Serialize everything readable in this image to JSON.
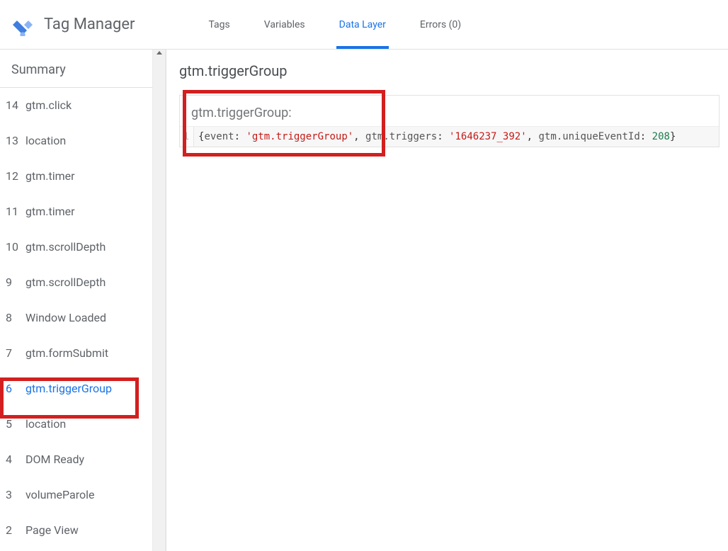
{
  "app_title": "Tag Manager",
  "tabs": [
    {
      "label": "Tags",
      "active": false
    },
    {
      "label": "Variables",
      "active": false
    },
    {
      "label": "Data Layer",
      "active": true
    },
    {
      "label": "Errors (0)",
      "active": false
    }
  ],
  "sidebar": {
    "summary_label": "Summary",
    "items": [
      {
        "num": "14",
        "label": "gtm.click"
      },
      {
        "num": "13",
        "label": "location"
      },
      {
        "num": "12",
        "label": "gtm.timer"
      },
      {
        "num": "11",
        "label": "gtm.timer"
      },
      {
        "num": "10",
        "label": "gtm.scrollDepth"
      },
      {
        "num": "9",
        "label": "gtm.scrollDepth"
      },
      {
        "num": "8",
        "label": "Window Loaded"
      },
      {
        "num": "7",
        "label": "gtm.formSubmit"
      },
      {
        "num": "6",
        "label": "gtm.triggerGroup",
        "active": true
      },
      {
        "num": "5",
        "label": "location"
      },
      {
        "num": "4",
        "label": "DOM Ready"
      },
      {
        "num": "3",
        "label": "volumeParole"
      },
      {
        "num": "2",
        "label": "Page View"
      }
    ]
  },
  "main": {
    "title": "gtm.triggerGroup",
    "panel_head": "gtm.triggerGroup:",
    "code": {
      "line_no": "1",
      "k_event": "event",
      "v_event": "'gtm.triggerGroup'",
      "k_triggers": "gtm.triggers",
      "v_triggers": "'1646237_392'",
      "k_uid": "gtm.uniqueEventId",
      "v_uid": "208"
    }
  }
}
